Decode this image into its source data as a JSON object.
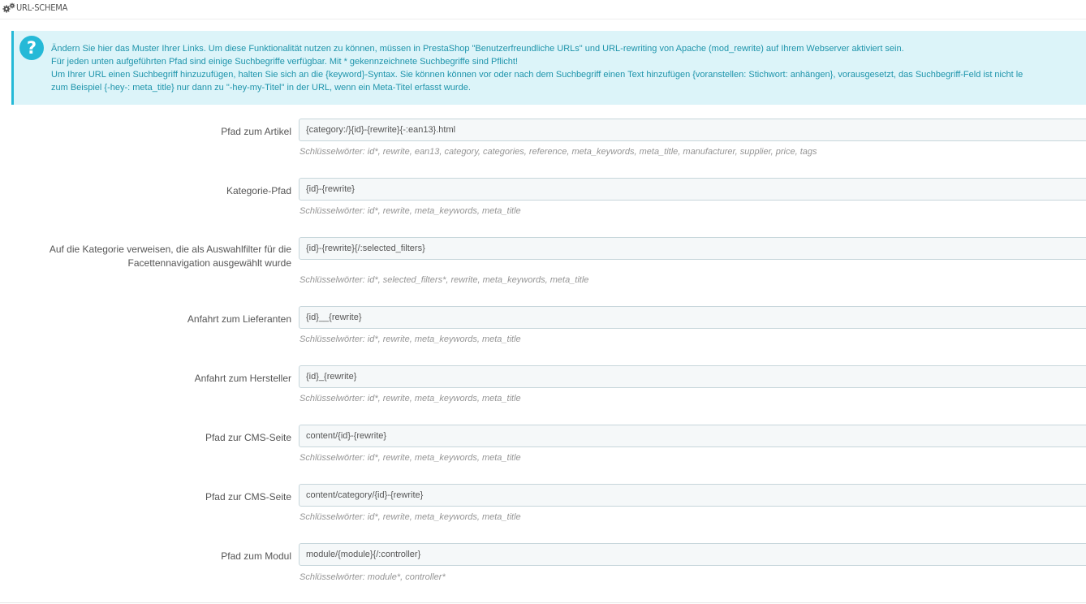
{
  "panel": {
    "title": "URL-SCHEMA",
    "icon": "cogs-icon"
  },
  "alert": {
    "icon": "question-icon",
    "color": "#25b9d7",
    "lines": [
      "Ändern Sie hier das Muster Ihrer Links. Um diese Funktionalität nutzen zu können, müssen in PrestaShop \"Benutzerfreundliche URLs\" und URL-rewriting von Apache (mod_rewrite) auf Ihrem Webserver aktiviert sein.",
      "Für jeden unten aufgeführten Pfad sind einige Suchbegriffe verfügbar. Mit * gekennzeichnete Suchbegriffe sind Pflicht!",
      "Um Ihrer URL einen Suchbegriff hinzuzufügen, halten Sie sich an die {keyword}-Syntax. Sie können können vor oder nach dem Suchbegriff einen Text hinzufügen {voranstellen: Stichwort: anhängen}, vorausgesetzt, das Suchbegriff-Feld ist nicht le",
      "zum Beispiel {-hey-: meta_title} nur dann zu \"-hey-my-Titel\" in der URL, wenn ein Meta-Titel erfasst wurde."
    ]
  },
  "fields": [
    {
      "label": "Pfad zum Artikel",
      "value": "{category:/}{id}-{rewrite}{-:ean13}.html",
      "hint": "Schlüsselwörter: id*, rewrite, ean13, category, categories, reference, meta_keywords, meta_title, manufacturer, supplier, price, tags"
    },
    {
      "label": "Kategorie-Pfad",
      "value": "{id}-{rewrite}",
      "hint": "Schlüsselwörter: id*, rewrite, meta_keywords, meta_title"
    },
    {
      "label": "Auf die Kategorie verweisen, die als Auswahlfilter für die Facettennavigation ausgewählt wurde",
      "value": "{id}-{rewrite}{/:selected_filters}",
      "hint": "Schlüsselwörter: id*, selected_filters*, rewrite, meta_keywords, meta_title"
    },
    {
      "label": "Anfahrt zum Lieferanten",
      "value": "{id}__{rewrite}",
      "hint": "Schlüsselwörter: id*, rewrite, meta_keywords, meta_title"
    },
    {
      "label": "Anfahrt zum Hersteller",
      "value": "{id}_{rewrite}",
      "hint": "Schlüsselwörter: id*, rewrite, meta_keywords, meta_title"
    },
    {
      "label": "Pfad zur CMS-Seite",
      "value": "content/{id}-{rewrite}",
      "hint": "Schlüsselwörter: id*, rewrite, meta_keywords, meta_title"
    },
    {
      "label": "Pfad zur CMS-Seite",
      "value": "content/category/{id}-{rewrite}",
      "hint": "Schlüsselwörter: id*, rewrite, meta_keywords, meta_title"
    },
    {
      "label": "Pfad zum Modul",
      "value": "module/{module}{/:controller}",
      "hint": "Schlüsselwörter: module*, controller*"
    }
  ]
}
